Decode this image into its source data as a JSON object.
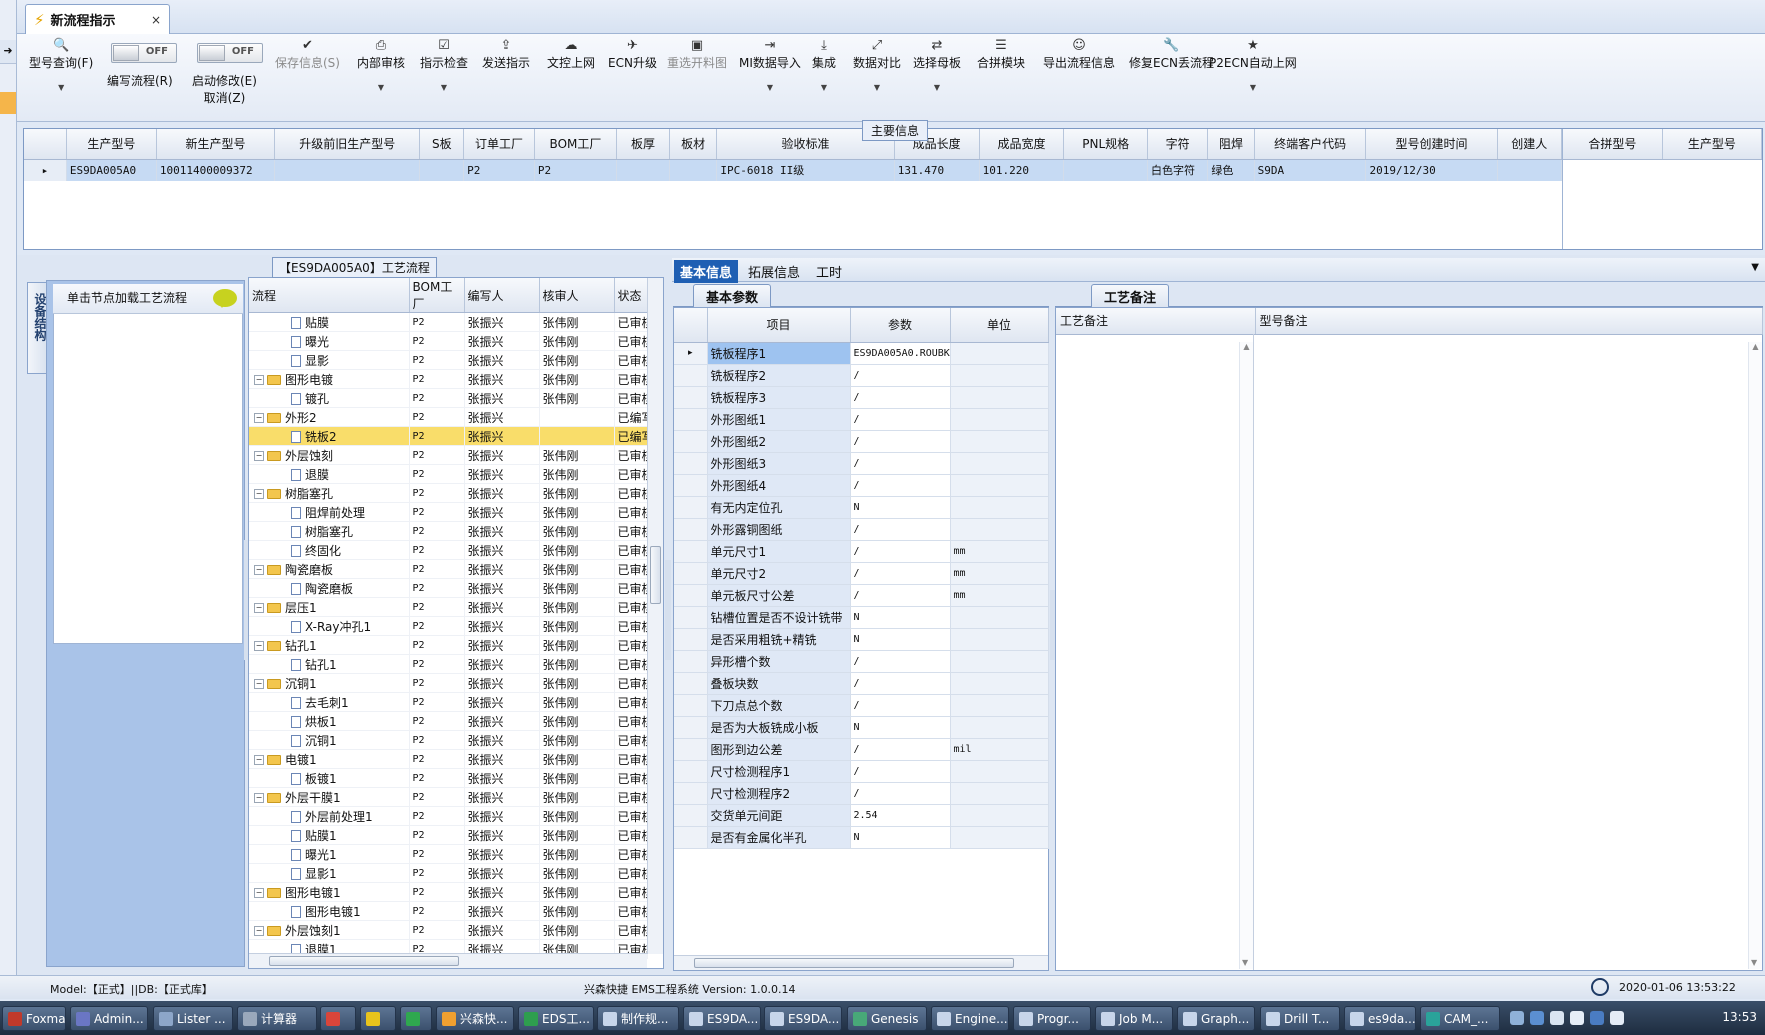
{
  "window": {
    "tab_title": "新流程指示",
    "tab_close": "×"
  },
  "toolbar": {
    "buttons": [
      {
        "label": "型号查询(F)",
        "icon": "search-icon",
        "dropdown": true,
        "disabled": false
      },
      {
        "label": "保存信息(S)",
        "icon": "check-icon",
        "dropdown": false,
        "disabled": true
      },
      {
        "label": "内部审核",
        "icon": "printer-icon",
        "dropdown": true,
        "disabled": false
      },
      {
        "label": "指示检查",
        "icon": "checkbox-icon",
        "dropdown": true,
        "disabled": false
      },
      {
        "label": "发送指示",
        "icon": "upload-icon",
        "dropdown": false,
        "disabled": false
      },
      {
        "label": "文控上网",
        "icon": "cloud-upload-icon",
        "dropdown": false,
        "disabled": false
      },
      {
        "label": "ECN升级",
        "icon": "plane-icon",
        "dropdown": false,
        "disabled": false
      },
      {
        "label": "重选开料图",
        "icon": "image-icon",
        "dropdown": false,
        "disabled": true
      },
      {
        "label": "MI数据导入",
        "icon": "import-icon",
        "dropdown": true,
        "disabled": false
      },
      {
        "label": "集成",
        "icon": "download-icon",
        "dropdown": true,
        "disabled": false
      },
      {
        "label": "数据对比",
        "icon": "compare-icon",
        "dropdown": true,
        "disabled": false
      },
      {
        "label": "选择母板",
        "icon": "shuffle-icon",
        "dropdown": true,
        "disabled": false
      },
      {
        "label": "合拼模块",
        "icon": "list-icon",
        "dropdown": false,
        "disabled": false
      },
      {
        "label": "导出流程信息",
        "icon": "smiley-icon",
        "dropdown": false,
        "disabled": false
      },
      {
        "label": "修复ECN丢流程",
        "icon": "wrench-icon",
        "dropdown": false,
        "disabled": false
      },
      {
        "label": "P2ECN自动上网",
        "icon": "star-icon",
        "dropdown": true,
        "disabled": false
      }
    ],
    "toggles": [
      {
        "state": "OFF",
        "label": "编写流程(R)"
      },
      {
        "state": "OFF",
        "label": "启动修改(E)",
        "label2": "取消(Z)"
      }
    ]
  },
  "main_info": {
    "title": "主要信息",
    "columns": [
      "生产型号",
      "新生产型号",
      "升级前旧生产型号",
      "S板",
      "订单工厂",
      "BOM工厂",
      "板厚",
      "板材",
      "验收标准",
      "成品长度",
      "成品宽度",
      "PNL规格",
      "字符",
      "阻焊",
      "终端客户代码",
      "型号创建时间",
      "创建人"
    ],
    "row": [
      "ES9DA005A0",
      "10011400009372",
      "",
      "",
      "P2",
      "P2",
      "",
      "",
      "IPC-6018 II级",
      "131.470",
      "101.220",
      "",
      "白色字符",
      "绿色",
      "S9DA",
      "2019/12/30",
      ""
    ],
    "side_columns": [
      "合拼型号",
      "生产型号"
    ]
  },
  "left_panel": {
    "vertical_tab": "设备结构",
    "header": "单击节点加载工艺流程"
  },
  "process_tree": {
    "title": "【ES9DA005A0】工艺流程",
    "columns": [
      "流程",
      "BOM工厂",
      "编写人",
      "核审人",
      "状态"
    ],
    "rows": [
      {
        "name": "贴膜",
        "level": 2,
        "type": "doc",
        "bom": "P2",
        "writer": "张振兴",
        "reviewer": "张伟刚",
        "status": "已审核"
      },
      {
        "name": "曝光",
        "level": 2,
        "type": "doc",
        "bom": "P2",
        "writer": "张振兴",
        "reviewer": "张伟刚",
        "status": "已审核"
      },
      {
        "name": "显影",
        "level": 2,
        "type": "doc",
        "bom": "P2",
        "writer": "张振兴",
        "reviewer": "张伟刚",
        "status": "已审核"
      },
      {
        "name": "图形电镀",
        "level": 1,
        "type": "folder",
        "bom": "P2",
        "writer": "张振兴",
        "reviewer": "张伟刚",
        "status": "已审核"
      },
      {
        "name": "镀孔",
        "level": 2,
        "type": "doc",
        "bom": "P2",
        "writer": "张振兴",
        "reviewer": "张伟刚",
        "status": "已审核"
      },
      {
        "name": "外形2",
        "level": 1,
        "type": "folder",
        "bom": "P2",
        "writer": "张振兴",
        "reviewer": "",
        "status": "已编写"
      },
      {
        "name": "铣板2",
        "level": 2,
        "type": "doc",
        "bom": "P2",
        "writer": "张振兴",
        "reviewer": "",
        "status": "已编写",
        "selected": true
      },
      {
        "name": "外层蚀刻",
        "level": 1,
        "type": "folder",
        "bom": "P2",
        "writer": "张振兴",
        "reviewer": "张伟刚",
        "status": "已审核"
      },
      {
        "name": "退膜",
        "level": 2,
        "type": "doc",
        "bom": "P2",
        "writer": "张振兴",
        "reviewer": "张伟刚",
        "status": "已审核"
      },
      {
        "name": "树脂塞孔",
        "level": 1,
        "type": "folder",
        "bom": "P2",
        "writer": "张振兴",
        "reviewer": "张伟刚",
        "status": "已审核"
      },
      {
        "name": "阻焊前处理",
        "level": 2,
        "type": "doc",
        "bom": "P2",
        "writer": "张振兴",
        "reviewer": "张伟刚",
        "status": "已审核"
      },
      {
        "name": "树脂塞孔",
        "level": 2,
        "type": "doc",
        "bom": "P2",
        "writer": "张振兴",
        "reviewer": "张伟刚",
        "status": "已审核"
      },
      {
        "name": "终固化",
        "level": 2,
        "type": "doc",
        "bom": "P2",
        "writer": "张振兴",
        "reviewer": "张伟刚",
        "status": "已审核"
      },
      {
        "name": "陶瓷磨板",
        "level": 1,
        "type": "folder",
        "bom": "P2",
        "writer": "张振兴",
        "reviewer": "张伟刚",
        "status": "已审核"
      },
      {
        "name": "陶瓷磨板",
        "level": 2,
        "type": "doc",
        "bom": "P2",
        "writer": "张振兴",
        "reviewer": "张伟刚",
        "status": "已审核"
      },
      {
        "name": "层压1",
        "level": 1,
        "type": "folder",
        "bom": "P2",
        "writer": "张振兴",
        "reviewer": "张伟刚",
        "status": "已审核"
      },
      {
        "name": "X-Ray冲孔1",
        "level": 2,
        "type": "doc",
        "bom": "P2",
        "writer": "张振兴",
        "reviewer": "张伟刚",
        "status": "已审核"
      },
      {
        "name": "钻孔1",
        "level": 1,
        "type": "folder",
        "bom": "P2",
        "writer": "张振兴",
        "reviewer": "张伟刚",
        "status": "已审核"
      },
      {
        "name": "钻孔1",
        "level": 2,
        "type": "doc",
        "bom": "P2",
        "writer": "张振兴",
        "reviewer": "张伟刚",
        "status": "已审核"
      },
      {
        "name": "沉铜1",
        "level": 1,
        "type": "folder",
        "bom": "P2",
        "writer": "张振兴",
        "reviewer": "张伟刚",
        "status": "已审核"
      },
      {
        "name": "去毛刺1",
        "level": 2,
        "type": "doc",
        "bom": "P2",
        "writer": "张振兴",
        "reviewer": "张伟刚",
        "status": "已审核"
      },
      {
        "name": "烘板1",
        "level": 2,
        "type": "doc",
        "bom": "P2",
        "writer": "张振兴",
        "reviewer": "张伟刚",
        "status": "已审核"
      },
      {
        "name": "沉铜1",
        "level": 2,
        "type": "doc",
        "bom": "P2",
        "writer": "张振兴",
        "reviewer": "张伟刚",
        "status": "已审核"
      },
      {
        "name": "电镀1",
        "level": 1,
        "type": "folder",
        "bom": "P2",
        "writer": "张振兴",
        "reviewer": "张伟刚",
        "status": "已审核"
      },
      {
        "name": "板镀1",
        "level": 2,
        "type": "doc",
        "bom": "P2",
        "writer": "张振兴",
        "reviewer": "张伟刚",
        "status": "已审核"
      },
      {
        "name": "外层干膜1",
        "level": 1,
        "type": "folder",
        "bom": "P2",
        "writer": "张振兴",
        "reviewer": "张伟刚",
        "status": "已审核"
      },
      {
        "name": "外层前处理1",
        "level": 2,
        "type": "doc",
        "bom": "P2",
        "writer": "张振兴",
        "reviewer": "张伟刚",
        "status": "已审核"
      },
      {
        "name": "贴膜1",
        "level": 2,
        "type": "doc",
        "bom": "P2",
        "writer": "张振兴",
        "reviewer": "张伟刚",
        "status": "已审核"
      },
      {
        "name": "曝光1",
        "level": 2,
        "type": "doc",
        "bom": "P2",
        "writer": "张振兴",
        "reviewer": "张伟刚",
        "status": "已审核"
      },
      {
        "name": "显影1",
        "level": 2,
        "type": "doc",
        "bom": "P2",
        "writer": "张振兴",
        "reviewer": "张伟刚",
        "status": "已审核"
      },
      {
        "name": "图形电镀1",
        "level": 1,
        "type": "folder",
        "bom": "P2",
        "writer": "张振兴",
        "reviewer": "张伟刚",
        "status": "已审核"
      },
      {
        "name": "图形电镀1",
        "level": 2,
        "type": "doc",
        "bom": "P2",
        "writer": "张振兴",
        "reviewer": "张伟刚",
        "status": "已审核"
      },
      {
        "name": "外层蚀刻1",
        "level": 1,
        "type": "folder",
        "bom": "P2",
        "writer": "张振兴",
        "reviewer": "张伟刚",
        "status": "已审核"
      },
      {
        "name": "退膜1",
        "level": 2,
        "type": "doc",
        "bom": "P2",
        "writer": "张振兴",
        "reviewer": "张伟刚",
        "status": "已审核"
      }
    ]
  },
  "right_tabs": [
    "基本信息",
    "拓展信息",
    "工时"
  ],
  "basic_params": {
    "tab": "基本参数",
    "columns": [
      "项目",
      "参数",
      "单位"
    ],
    "rows": [
      {
        "name": "铣板程序1",
        "value": "ES9DA005A0.ROUBK",
        "unit": "",
        "selected": true
      },
      {
        "name": "铣板程序2",
        "value": "/",
        "unit": ""
      },
      {
        "name": "铣板程序3",
        "value": "/",
        "unit": ""
      },
      {
        "name": "外形图纸1",
        "value": "/",
        "unit": ""
      },
      {
        "name": "外形图纸2",
        "value": "/",
        "unit": ""
      },
      {
        "name": "外形图纸3",
        "value": "/",
        "unit": ""
      },
      {
        "name": "外形图纸4",
        "value": "/",
        "unit": ""
      },
      {
        "name": "有无内定位孔",
        "value": "N",
        "unit": ""
      },
      {
        "name": "外形露铜图纸",
        "value": "/",
        "unit": ""
      },
      {
        "name": "单元尺寸1",
        "value": "/",
        "unit": "mm"
      },
      {
        "name": "单元尺寸2",
        "value": "/",
        "unit": "mm"
      },
      {
        "name": "单元板尺寸公差",
        "value": "/",
        "unit": "mm"
      },
      {
        "name": "钻槽位置是否不设计铣带",
        "value": "N",
        "unit": ""
      },
      {
        "name": "是否采用粗铣+精铣",
        "value": "N",
        "unit": ""
      },
      {
        "name": "异形槽个数",
        "value": "/",
        "unit": ""
      },
      {
        "name": "叠板块数",
        "value": "/",
        "unit": ""
      },
      {
        "name": "下刀点总个数",
        "value": "/",
        "unit": ""
      },
      {
        "name": "是否为大板铣成小板",
        "value": "N",
        "unit": ""
      },
      {
        "name": "图形到边公差",
        "value": "/",
        "unit": "mil"
      },
      {
        "name": "尺寸检测程序1",
        "value": "/",
        "unit": ""
      },
      {
        "name": "尺寸检测程序2",
        "value": "/",
        "unit": ""
      },
      {
        "name": "交货单元间距",
        "value": "2.54",
        "unit": ""
      },
      {
        "name": "是否有金属化半孔",
        "value": "N",
        "unit": ""
      }
    ]
  },
  "process_notes": {
    "tab": "工艺备注",
    "columns": [
      "工艺备注",
      "型号备注"
    ]
  },
  "status_bar": {
    "model": "Model:【正式】||DB:【正式库】",
    "version": "兴森快捷 EMS工程系统 Version: 1.0.0.14",
    "datetime": "2020-01-06 13:53:22"
  },
  "taskbar": {
    "items": [
      {
        "label": "Foxmail",
        "color": "#c0392b"
      },
      {
        "label": "Admin...",
        "color": "#6a76c4"
      },
      {
        "label": "Lister ...",
        "color": "#8da6c9"
      },
      {
        "label": "计算器",
        "color": "#9aa8bb"
      },
      {
        "label": "",
        "color": "#d9453a"
      },
      {
        "label": "",
        "color": "#e8c31c"
      },
      {
        "label": "",
        "color": "#2fa84f"
      },
      {
        "label": "兴森快...",
        "color": "#f0a030"
      },
      {
        "label": "EDS工...",
        "color": "#2e9e4e"
      },
      {
        "label": "制作规...",
        "color": "#c7d5ea"
      },
      {
        "label": "ES9DA...",
        "color": "#c7d5ea"
      },
      {
        "label": "ES9DA...",
        "color": "#c7d5ea"
      },
      {
        "label": "Genesis",
        "color": "#48a878"
      },
      {
        "label": "Engine...",
        "color": "#c7d5ea"
      },
      {
        "label": "Progr...",
        "color": "#c7d5ea"
      },
      {
        "label": "Job M...",
        "color": "#c7d5ea"
      },
      {
        "label": "Graph...",
        "color": "#c7d5ea"
      },
      {
        "label": "Drill T...",
        "color": "#c7d5ea"
      },
      {
        "label": "es9da...",
        "color": "#c7d5ea"
      },
      {
        "label": "CAM_...",
        "color": "#2aa39a"
      }
    ],
    "clock": "13:53"
  }
}
